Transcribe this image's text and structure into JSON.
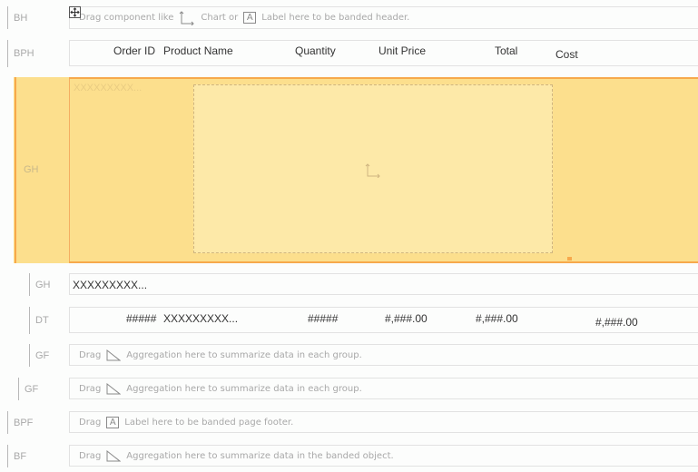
{
  "bands": {
    "bh": {
      "label": "BH",
      "hint_pre": "Drag component like",
      "hint_mid": "Chart or",
      "hint_post": "Label here to be banded header.",
      "icons": [
        "chart-axis-icon",
        "label-a-icon"
      ]
    },
    "bph": {
      "label": "BPH",
      "columns": [
        "Order ID",
        "Product Name",
        "Quantity",
        "Unit Price",
        "Total",
        "Cost"
      ]
    },
    "gh_selected": {
      "label": "GH",
      "field_placeholder": "XXXXXXXXX...",
      "accent_color": "#f7a94c",
      "fill_color": "#fcdf8d"
    },
    "gh": {
      "label": "GH",
      "field_value": "XXXXXXXXX..."
    },
    "dt": {
      "label": "DT",
      "cells": [
        "#####",
        "XXXXXXXXX...",
        "#####",
        "#,###.00",
        "#,###.00",
        "#,###.00"
      ]
    },
    "gf1": {
      "label": "GF",
      "hint_pre": "Drag",
      "hint_post": "Aggregation here to summarize data in each group."
    },
    "gf2": {
      "label": "GF",
      "hint_pre": "Drag",
      "hint_post": "Aggregation here to summarize data in each group."
    },
    "bpf": {
      "label": "BPF",
      "hint_pre": "Drag",
      "hint_post": "Label here to be banded page footer."
    },
    "bf": {
      "label": "BF",
      "hint_pre": "Drag",
      "hint_post": "Aggregation here to summarize data in the banded object."
    }
  },
  "icons": {
    "label_glyph": "A"
  }
}
